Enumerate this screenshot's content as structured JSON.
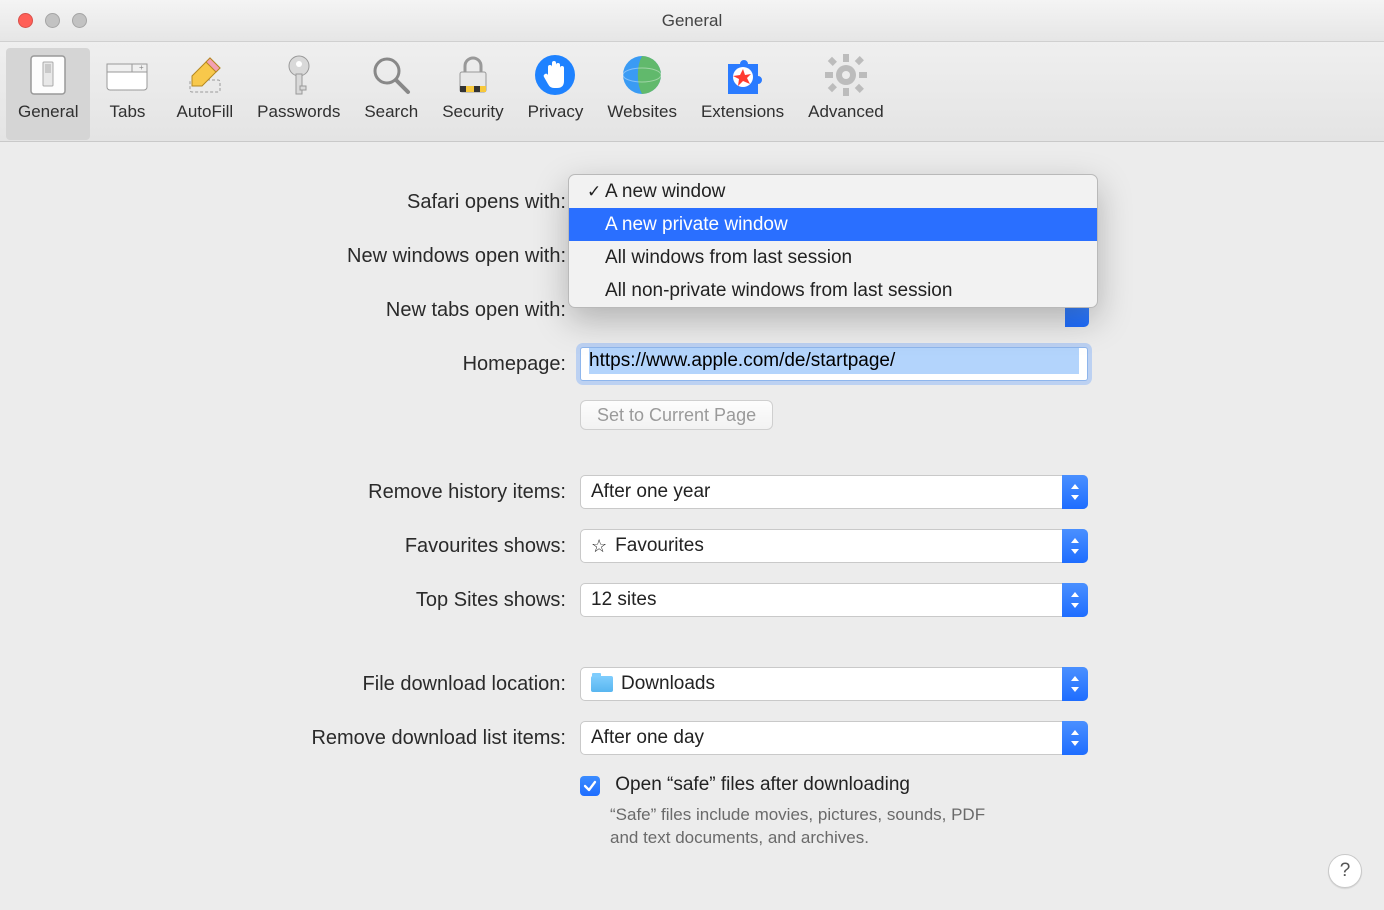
{
  "window": {
    "title": "General"
  },
  "toolbar": {
    "items": [
      {
        "label": "General"
      },
      {
        "label": "Tabs"
      },
      {
        "label": "AutoFill"
      },
      {
        "label": "Passwords"
      },
      {
        "label": "Search"
      },
      {
        "label": "Security"
      },
      {
        "label": "Privacy"
      },
      {
        "label": "Websites"
      },
      {
        "label": "Extensions"
      },
      {
        "label": "Advanced"
      }
    ]
  },
  "form": {
    "safari_opens_label": "Safari opens with:",
    "new_windows_label": "New windows open with:",
    "new_tabs_label": "New tabs open with:",
    "homepage_label": "Homepage:",
    "homepage_value": "https://www.apple.com/de/startpage/",
    "set_current_label": "Set to Current Page",
    "remove_history_label": "Remove history items:",
    "remove_history_value": "After one year",
    "favourites_label": "Favourites shows:",
    "favourites_value": "Favourites",
    "topsites_label": "Top Sites shows:",
    "topsites_value": "12 sites",
    "download_loc_label": "File download location:",
    "download_loc_value": "Downloads",
    "remove_downloads_label": "Remove download list items:",
    "remove_downloads_value": "After one day",
    "safe_files_label": "Open “safe” files after downloading",
    "safe_files_help": "“Safe” files include movies, pictures, sounds, PDF and text documents, and archives."
  },
  "dropdown": {
    "options": [
      "A new window",
      "A new private window",
      "All windows from last session",
      "All non-private windows from last session"
    ],
    "checked_index": 0,
    "highlight_index": 1
  },
  "help_button": "?"
}
